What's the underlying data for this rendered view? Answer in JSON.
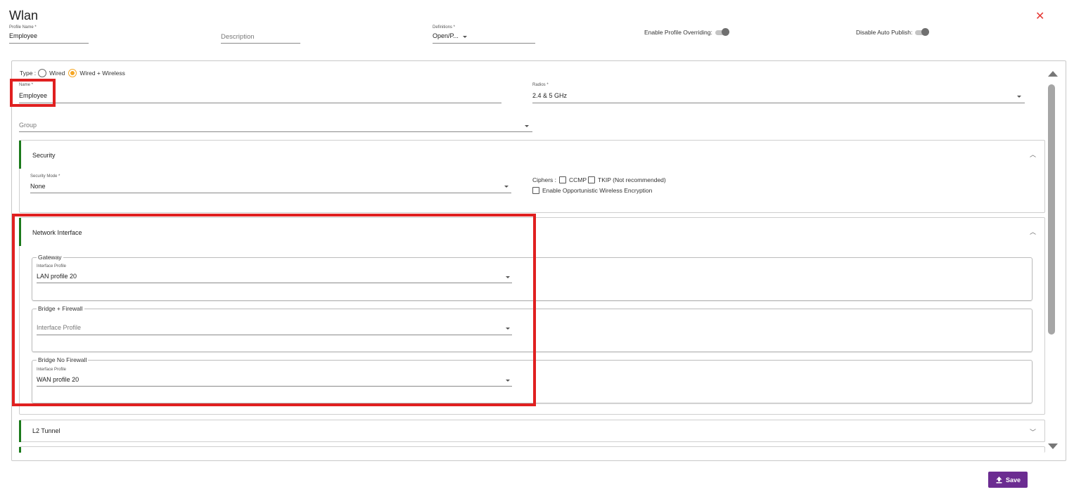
{
  "header": {
    "title": "Wlan",
    "profile_name": {
      "label": "Profile Name *",
      "value": "Employee"
    },
    "description": {
      "placeholder": "Description"
    },
    "definitions": {
      "label": "Definitions *",
      "value": "Open/P..."
    },
    "enable_profile_overriding": {
      "label": "Enable Profile Overriding:",
      "on": false
    },
    "disable_auto_publish": {
      "label": "Disable Auto Publish:",
      "on": false
    }
  },
  "type": {
    "label": "Type :",
    "options": [
      "Wired",
      "Wired + Wireless"
    ],
    "selected": "Wired + Wireless"
  },
  "name_field": {
    "label": "Name *",
    "value": "Employee"
  },
  "radios_field": {
    "label": "Radios *",
    "value": "2.4 & 5 GHz"
  },
  "group_field": {
    "placeholder": "Group"
  },
  "security": {
    "title": "Security",
    "mode": {
      "label": "Security Mode *",
      "value": "None"
    },
    "ciphers_label": "Ciphers :",
    "ciphers": [
      {
        "label": "CCMP",
        "checked": false
      },
      {
        "label": "TKIP (Not recommended)",
        "checked": false
      }
    ],
    "owe": {
      "label": "Enable Opportunistic Wireless Encryption",
      "checked": false
    }
  },
  "network_interface": {
    "title": "Network Interface",
    "gateway": {
      "legend": "Gateway",
      "label": "Interface Profile",
      "value": "LAN profile 20"
    },
    "bridge_firewall": {
      "legend": "Bridge + Firewall",
      "placeholder": "Interface Profile"
    },
    "bridge_no_firewall": {
      "legend": "Bridge No Firewall",
      "label": "Interface Profile",
      "value": "WAN profile 20"
    }
  },
  "l2_tunnel": {
    "title": "L2 Tunnel"
  },
  "actions": {
    "save_label": "Save"
  },
  "colors": {
    "accent_green": "#1b7a1b",
    "save_purple": "#6b2c91",
    "highlight_red": "#e02020",
    "radio_orange": "#f5a623",
    "close_red": "#e53935"
  },
  "icons": {
    "close": "close-icon",
    "upload": "upload-icon",
    "chevron_up": "chevron-up-icon",
    "chevron_down": "chevron-down-icon"
  }
}
